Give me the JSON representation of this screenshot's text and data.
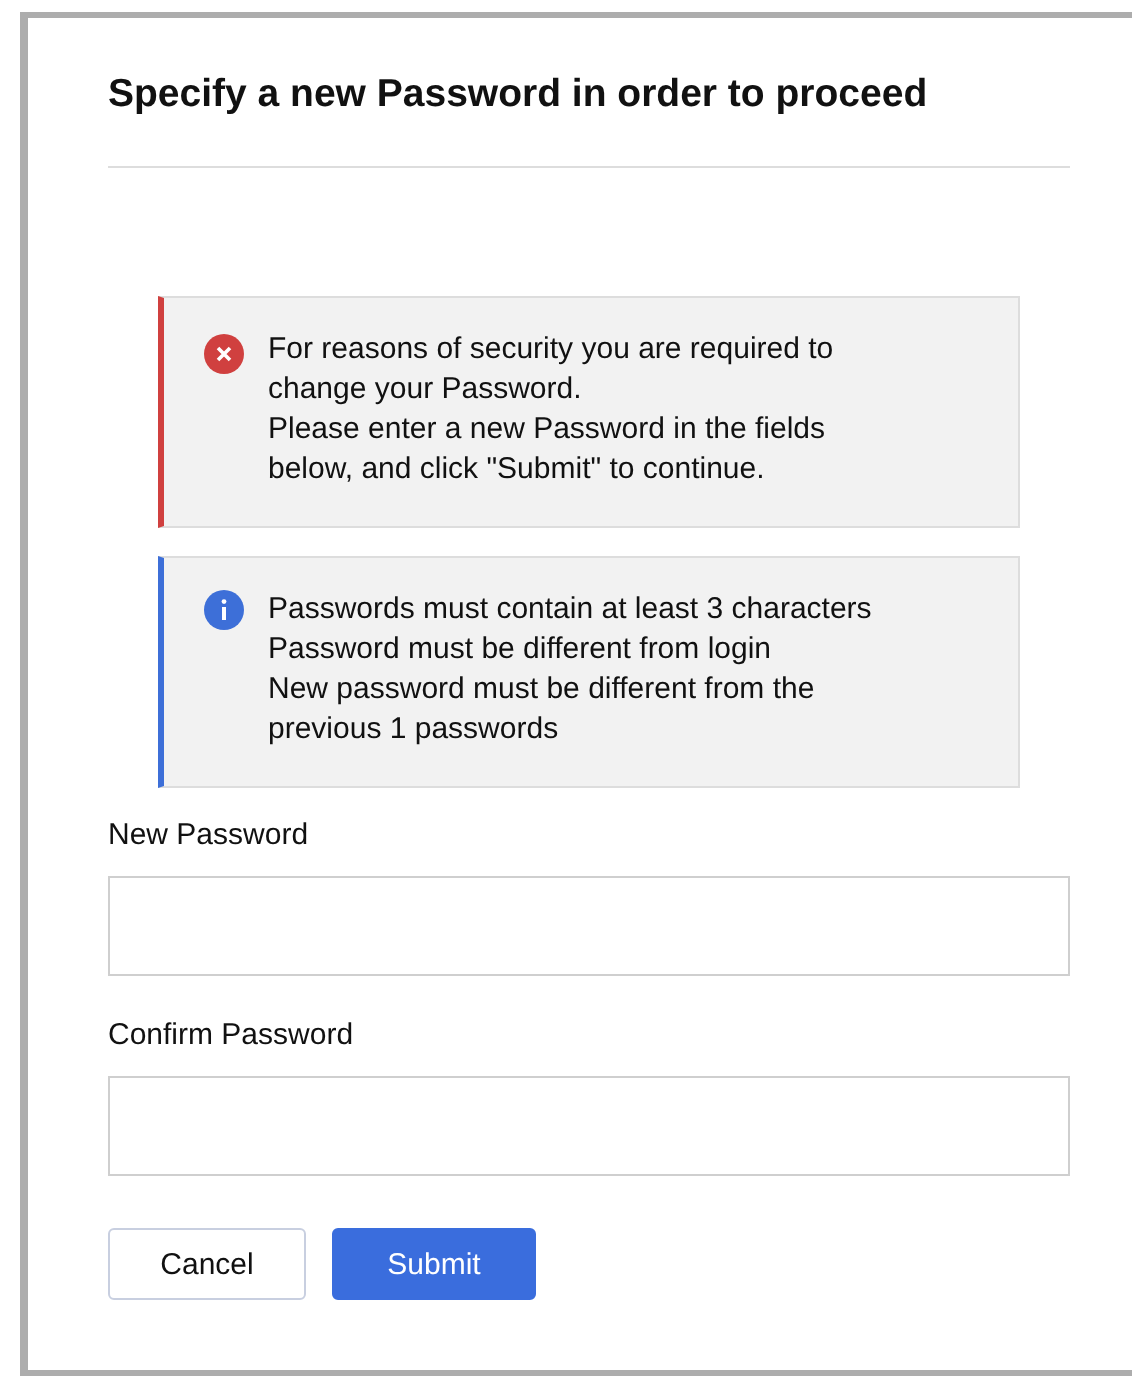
{
  "title": "Specify a new Password in order to proceed",
  "alerts": [
    {
      "kind": "error",
      "lines": [
        "For reasons of security you are required to",
        "change your Password.",
        "Please enter a new Password in the fields",
        "below, and click \"Submit\" to continue."
      ]
    },
    {
      "kind": "info",
      "lines": [
        "Passwords must contain at least 3 characters",
        "Password must be different from login",
        "New password must be different from the",
        "previous 1 passwords"
      ]
    }
  ],
  "fields": [
    {
      "label": "New Password"
    },
    {
      "label": "Confirm Password"
    }
  ],
  "buttons": [
    {
      "label": "Cancel",
      "kind": "secondary"
    },
    {
      "label": "Submit",
      "kind": "primary"
    }
  ]
}
